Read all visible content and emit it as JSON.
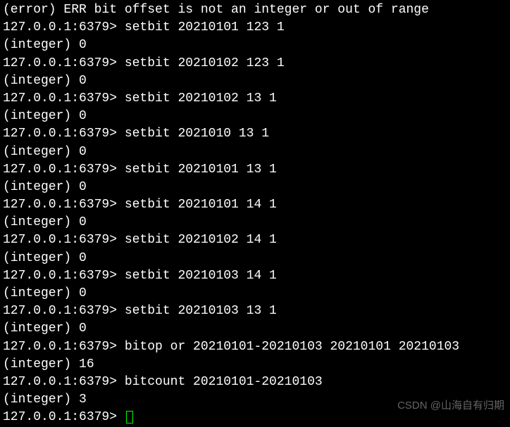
{
  "terminal": {
    "prompt": "127.0.0.1:6379>",
    "error_line": "(error) ERR bit offset is not an integer or out of range",
    "lines": [
      {
        "type": "error",
        "text": "(error) ERR bit offset is not an integer or out of range"
      },
      {
        "type": "cmd",
        "cmd": "setbit 20210101 123 1"
      },
      {
        "type": "out",
        "text": "(integer) 0"
      },
      {
        "type": "cmd",
        "cmd": "setbit 20210102 123 1"
      },
      {
        "type": "out",
        "text": "(integer) 0"
      },
      {
        "type": "cmd",
        "cmd": "setbit 20210102 13 1"
      },
      {
        "type": "out",
        "text": "(integer) 0"
      },
      {
        "type": "cmd",
        "cmd": "setbit 2021010 13 1"
      },
      {
        "type": "out",
        "text": "(integer) 0"
      },
      {
        "type": "cmd",
        "cmd": "setbit 20210101 13 1"
      },
      {
        "type": "out",
        "text": "(integer) 0"
      },
      {
        "type": "cmd",
        "cmd": "setbit 20210101 14 1"
      },
      {
        "type": "out",
        "text": "(integer) 0"
      },
      {
        "type": "cmd",
        "cmd": "setbit 20210102 14 1"
      },
      {
        "type": "out",
        "text": "(integer) 0"
      },
      {
        "type": "cmd",
        "cmd": "setbit 20210103 14 1"
      },
      {
        "type": "out",
        "text": "(integer) 0"
      },
      {
        "type": "cmd",
        "cmd": "setbit 20210103 13 1"
      },
      {
        "type": "out",
        "text": "(integer) 0"
      },
      {
        "type": "cmd",
        "cmd": "bitop or 20210101-20210103 20210101 20210103"
      },
      {
        "type": "out",
        "text": "(integer) 16"
      },
      {
        "type": "cmd",
        "cmd": "bitcount 20210101-20210103"
      },
      {
        "type": "out",
        "text": "(integer) 3"
      },
      {
        "type": "cmd",
        "cmd": "",
        "cursor": true
      }
    ]
  },
  "watermark": "CSDN @山海自有归期"
}
